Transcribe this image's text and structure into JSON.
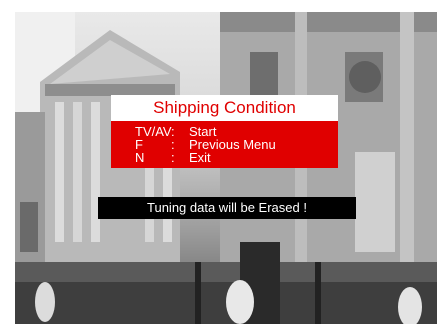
{
  "menu": {
    "title": "Shipping Condition",
    "items": [
      {
        "key": "TV/AV",
        "separator": ":",
        "action": "Start"
      },
      {
        "key": "F",
        "separator": ":",
        "action": "Previous Menu"
      },
      {
        "key": "N",
        "separator": ":",
        "action": "Exit"
      }
    ]
  },
  "warning": "Tuning data will be Erased !",
  "colors": {
    "title_background": "#ffffff",
    "title_text": "#e00000",
    "menu_background": "#e00000",
    "menu_text": "#ffffff",
    "warning_background": "#000000",
    "warning_text": "#ffffff"
  }
}
